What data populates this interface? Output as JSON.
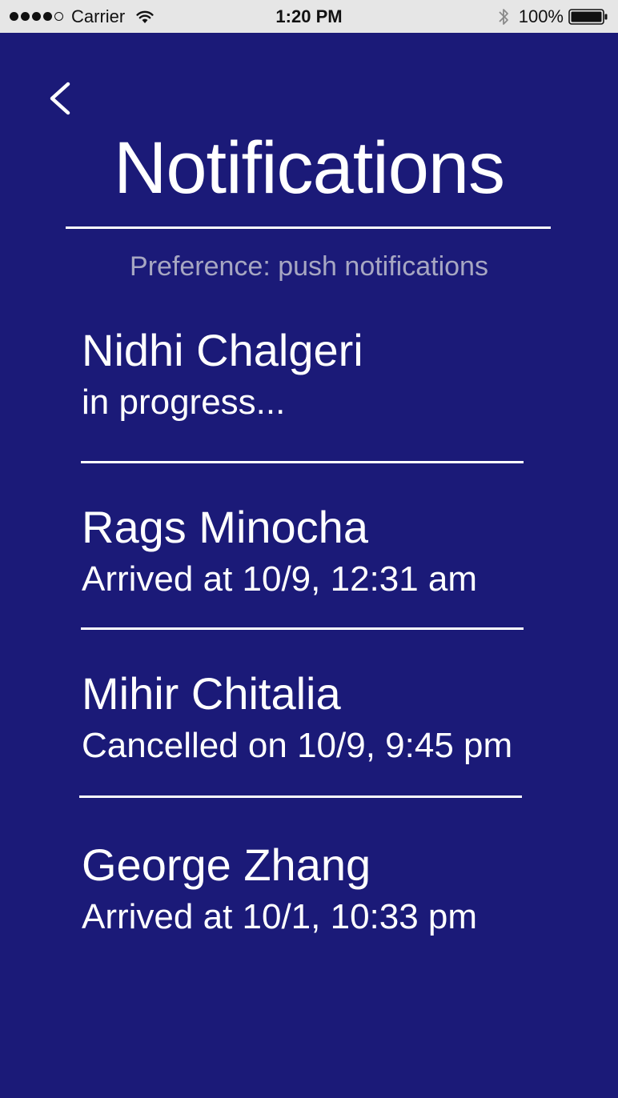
{
  "status_bar": {
    "carrier": "Carrier",
    "time": "1:20 PM",
    "battery_percent": "100%",
    "signal_strength": 4,
    "signal_max": 5,
    "battery_level": 1.0
  },
  "header": {
    "title": "Notifications",
    "preference": "Preference: push notifications"
  },
  "notifications": [
    {
      "name": "Nidhi Chalgeri",
      "status": "in progress..."
    },
    {
      "name": "Rags Minocha",
      "status": "Arrived at 10/9, 12:31 am"
    },
    {
      "name": "Mihir Chitalia",
      "status": "Cancelled on 10/9, 9:45 pm"
    },
    {
      "name": "George Zhang",
      "status": "Arrived at 10/1, 10:33 pm"
    }
  ],
  "icons": {
    "back": "chevron-left-icon",
    "wifi": "wifi-icon",
    "bluetooth": "bluetooth-icon",
    "battery": "battery-icon"
  },
  "colors": {
    "background": "#1b1a78",
    "status_bar": "#e6e6e6",
    "text": "#ffffff",
    "muted_text": "#a7a7c2"
  }
}
